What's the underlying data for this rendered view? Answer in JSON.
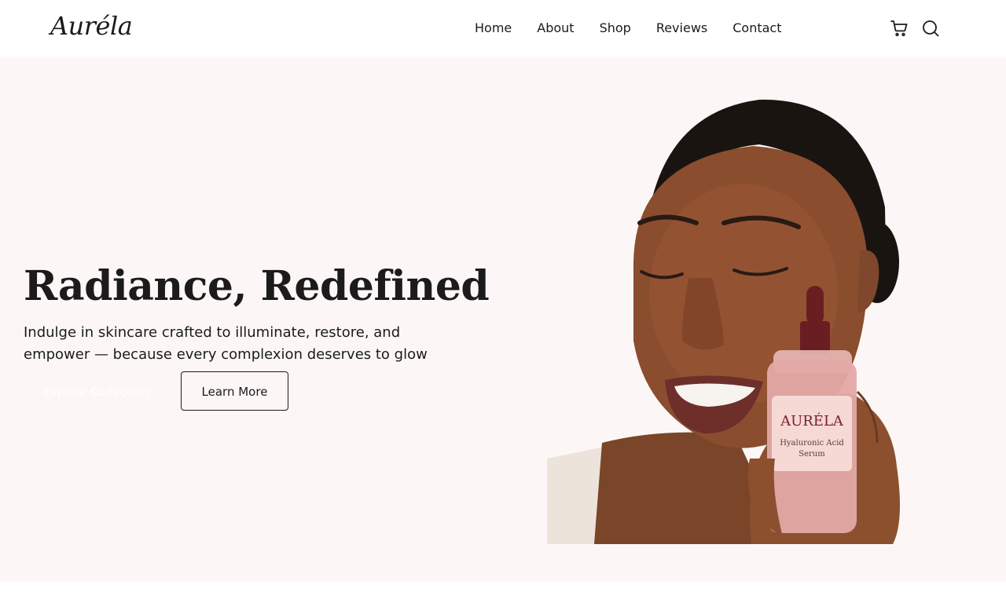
{
  "header": {
    "logo": "Auréla",
    "nav": [
      {
        "label": "Home"
      },
      {
        "label": "About"
      },
      {
        "label": "Shop"
      },
      {
        "label": "Reviews"
      },
      {
        "label": "Contact"
      }
    ],
    "icons": [
      "cart-icon",
      "search-icon"
    ]
  },
  "hero": {
    "title": "Radiance, Redefined",
    "subtitle": "Indulge in skincare crafted to illuminate, restore, and empower — because every complexion deserves to glow",
    "primary_button": "Explore Collection",
    "secondary_button": "Learn More",
    "product": {
      "brand": "AURÉLA",
      "name_line1": "Hyaluronic Acid",
      "name_line2": "Serum"
    }
  },
  "colors": {
    "hero_bg": "#fcf7f6",
    "text": "#1b1b1b",
    "bottle_cap": "#6b1e22"
  }
}
